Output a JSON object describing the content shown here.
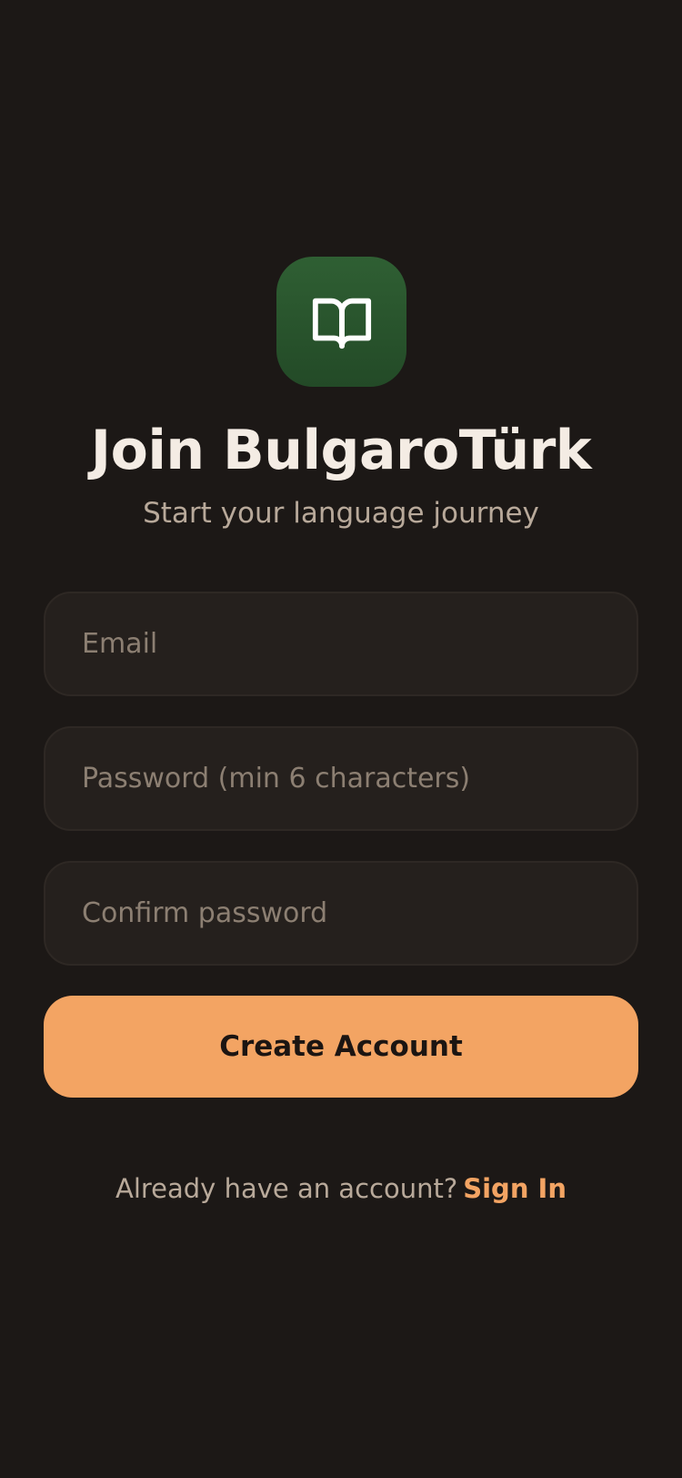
{
  "header": {
    "logo_icon": "open-book-icon",
    "title": "Join BulgaroTürk",
    "subtitle": "Start your language journey"
  },
  "form": {
    "email_placeholder": "Email",
    "password_placeholder": "Password (min 6 characters)",
    "confirm_placeholder": "Confirm password",
    "submit_label": "Create Account"
  },
  "footer": {
    "prompt": "Already have an account?",
    "signin_label": "Sign In"
  },
  "colors": {
    "background": "#1c1816",
    "accent": "#f3a463",
    "logo_green": "#2f5f33"
  }
}
